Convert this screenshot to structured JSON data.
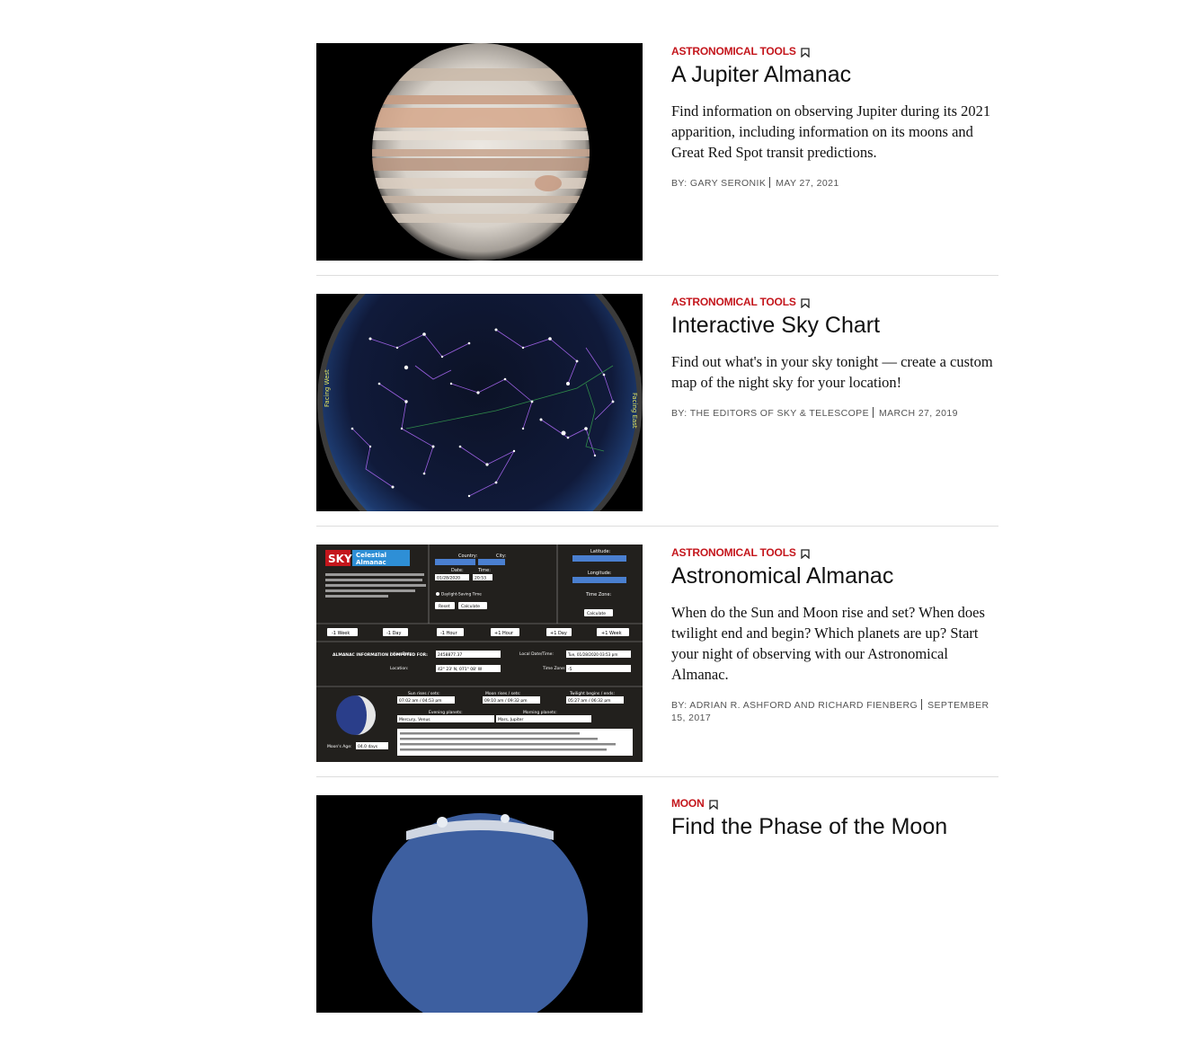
{
  "articles": [
    {
      "category": "ASTRONOMICAL TOOLS",
      "title": "A Jupiter Almanac",
      "excerpt": "Find information on observing Jupiter during its 2021 apparition, including information on its moons and Great Red Spot transit predictions.",
      "by_label": "BY:",
      "author": "GARY SERONIK",
      "date": "MAY 27, 2021",
      "image": "jupiter-photo"
    },
    {
      "category": "ASTRONOMICAL TOOLS",
      "title": "Interactive Sky Chart",
      "excerpt": "Find out what's in your sky tonight — create a custom map of the night sky for your location!",
      "by_label": "BY:",
      "author": "THE EDITORS OF SKY & TELESCOPE",
      "date": "MARCH 27, 2019",
      "image": "sky-chart-screenshot"
    },
    {
      "category": "ASTRONOMICAL TOOLS",
      "title": "Astronomical Almanac",
      "excerpt": "When do the Sun and Moon rise and set? When does twilight end and begin? Which planets are up? Start your night of observing with our Astronomical Almanac.",
      "by_label": "BY:",
      "author": "ADRIAN R. ASHFORD AND RICHARD FIENBERG",
      "date": "SEPTEMBER 15, 2017",
      "image": "almanac-screenshot",
      "almanac_ui": {
        "brand": "SKY",
        "header_line1": "Celestial",
        "header_line2": "Almanac",
        "country_label": "Country:",
        "city_label": "City:",
        "latitude_label": "Latitude:",
        "longitude_label": "Longitude:",
        "date_label": "Date:",
        "time_label": "Time:",
        "date_value": "01/28/2020",
        "time_value": "20:53",
        "dst_label": "Daylight-Saving Time",
        "reset_btn": "Reset",
        "calc_btn": "Calculate",
        "timezone_label": "Time Zone:",
        "step_buttons": [
          "-1 Week",
          "-1 Day",
          "-1 Hour",
          "+1 Hour",
          "+1 Day",
          "+1 Week"
        ],
        "info_label": "ALMANAC INFORMATION COMPUTED FOR:",
        "julian_label": "Julian Date:",
        "julian_value": "2458877.37",
        "location_label": "Location:",
        "location_value": "42° 23' N, 071° 08' W",
        "local_label": "Local Date/Time:",
        "local_value": "Tue, 01/28/2020 03:53 pm",
        "tz_label": "Time Zone:",
        "tz_value": "-5",
        "sun_label": "Sun rises / sets:",
        "sun_value": "07:02 am / 04:53 pm",
        "moon_label": "Moon rises / sets:",
        "moon_value": "09:10 am / 09:32 pm",
        "twilight_label": "Twilight begins / ends:",
        "twilight_value": "05:27 am / 06:32 pm",
        "evening_label": "Evening planets:",
        "evening_value": "Mercury, Venus",
        "morning_label": "Morning planets:",
        "morning_value": "Mars, Jupiter",
        "moon_age_label": "Moon's Age:",
        "moon_age_value": "04.0 days"
      }
    },
    {
      "category": "MOON",
      "title": "Find the Phase of the Moon",
      "excerpt": "",
      "by_label": "",
      "author": "",
      "date": "",
      "image": "moon-photo"
    }
  ]
}
